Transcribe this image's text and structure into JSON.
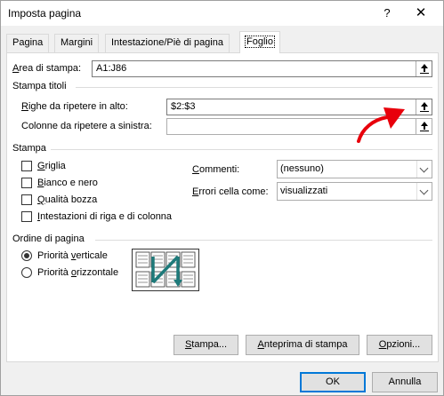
{
  "window": {
    "title": "Imposta pagina",
    "help_icon": "?",
    "close_icon": "✕"
  },
  "tabs": [
    {
      "label": "Pagina",
      "active": false
    },
    {
      "label": "Margini",
      "active": false
    },
    {
      "label": "Intestazione/Piè di pagina",
      "active": false
    },
    {
      "label": "Foglio",
      "active": true
    }
  ],
  "print_area": {
    "label_underlined": "A",
    "label_rest": "rea di stampa:",
    "value": "A1:J86"
  },
  "print_titles": {
    "group_label": "Stampa titoli",
    "rows_label_prefix": "",
    "rows_label_underlined": "R",
    "rows_label_rest": "ighe da ripetere in alto:",
    "rows_value": "$2:$3",
    "cols_label": "Colonne da ripetere a sinistra:",
    "cols_value": ""
  },
  "print": {
    "group_label": "Stampa",
    "checkboxes": [
      {
        "underlined": "G",
        "rest": "riglia",
        "checked": false
      },
      {
        "underlined": "B",
        "rest": "ianco e nero",
        "checked": false
      },
      {
        "underlined": "Q",
        "rest": "ualità bozza",
        "checked": false
      },
      {
        "underlined": "I",
        "rest": "ntestazioni di riga e di colonna",
        "checked": false
      }
    ],
    "comments_label_underlined": "C",
    "comments_label_rest": "ommenti:",
    "comments_value": "(nessuno)",
    "errors_label_underlined": "E",
    "errors_label_rest": "rrori cella come:",
    "errors_value": "visualizzati"
  },
  "page_order": {
    "group_label": "Ordine di pagina",
    "options": [
      {
        "prefix": "Priorità ",
        "underlined": "v",
        "rest": "erticale",
        "checked": true
      },
      {
        "prefix": "Priorità ",
        "underlined": "o",
        "rest": "rizzontale",
        "checked": false
      }
    ]
  },
  "buttons": {
    "print_underlined": "S",
    "print_rest": "tampa...",
    "preview_underlined": "A",
    "preview_rest": "nteprima di stampa",
    "options_underlined": "O",
    "options_rest": "pzioni...",
    "ok": "OK",
    "cancel": "Annulla"
  },
  "colors": {
    "annotation_arrow": "#e8000b",
    "order_arrow": "#1e7a7a",
    "default_button_border": "#0078d7"
  }
}
